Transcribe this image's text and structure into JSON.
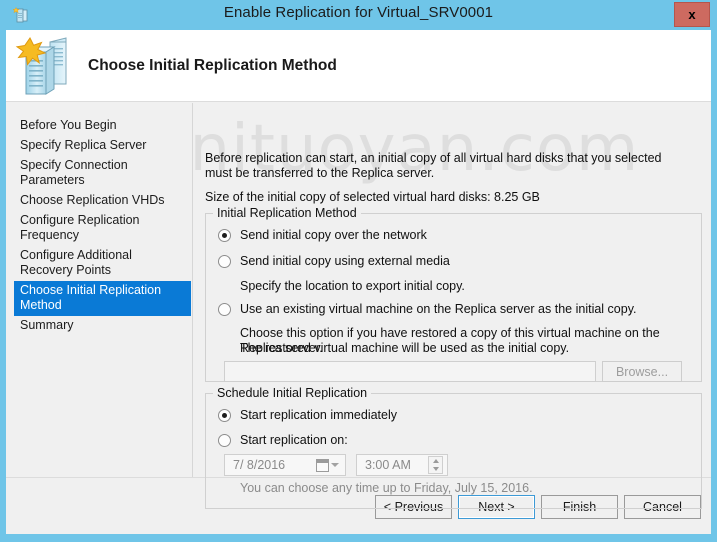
{
  "window": {
    "title": "Enable Replication for Virtual_SRV0001",
    "icon": "server-replication-icon",
    "close_label": "x",
    "accent_color": "#6fc5e8",
    "selection_color": "#0a7ad6",
    "close_color": "#cd6a60"
  },
  "header": {
    "title": "Choose Initial Replication Method",
    "icon": "two-servers-star-icon"
  },
  "watermark": {
    "text": "firnituoyan.com"
  },
  "sidebar": {
    "items": [
      {
        "label": "Before You Begin",
        "selected": false
      },
      {
        "label": "Specify Replica Server",
        "selected": false
      },
      {
        "label": "Specify Connection Parameters",
        "selected": false
      },
      {
        "label": "Choose Replication VHDs",
        "selected": false
      },
      {
        "label": "Configure Replication Frequency",
        "selected": false
      },
      {
        "label": "Configure Additional Recovery Points",
        "selected": false
      },
      {
        "label": "Choose Initial Replication Method",
        "selected": true
      },
      {
        "label": "Summary",
        "selected": false
      }
    ]
  },
  "main": {
    "intro_paragraph": "Before replication can start, an initial copy of all virtual hard disks that you selected must be transferred to the Replica server.",
    "size_line": "Size of the initial copy of selected virtual hard disks:  8.25 GB",
    "method_group": {
      "title": "Initial Replication Method",
      "options": [
        {
          "label": "Send initial copy over the network",
          "checked": true
        },
        {
          "label": "Send initial copy using external media",
          "checked": false
        },
        {
          "label": "Use an existing virtual machine on the Replica server as the initial copy.",
          "checked": false
        }
      ],
      "export_hint": "Specify the location to export initial copy.",
      "export_path_value": "",
      "export_path_placeholder": "",
      "browse_label": "Browse...",
      "existing_vm_help_line1": "Choose this option if you have restored a copy of this virtual machine on the Replica server.",
      "existing_vm_help_line2": "The restored virtual machine will be used as the initial copy."
    },
    "schedule_group": {
      "title": "Schedule Initial Replication",
      "options": [
        {
          "label": "Start replication immediately",
          "checked": true
        },
        {
          "label": "Start replication on:",
          "checked": false
        }
      ],
      "date_value": "7/ 8/2016",
      "time_value": "3:00 AM",
      "hint": "You can choose any time up to Friday, July 15, 2016."
    }
  },
  "footer": {
    "previous_label": "< Previous",
    "next_label": "Next >",
    "finish_label": "Finish",
    "cancel_label": "Cancel"
  }
}
